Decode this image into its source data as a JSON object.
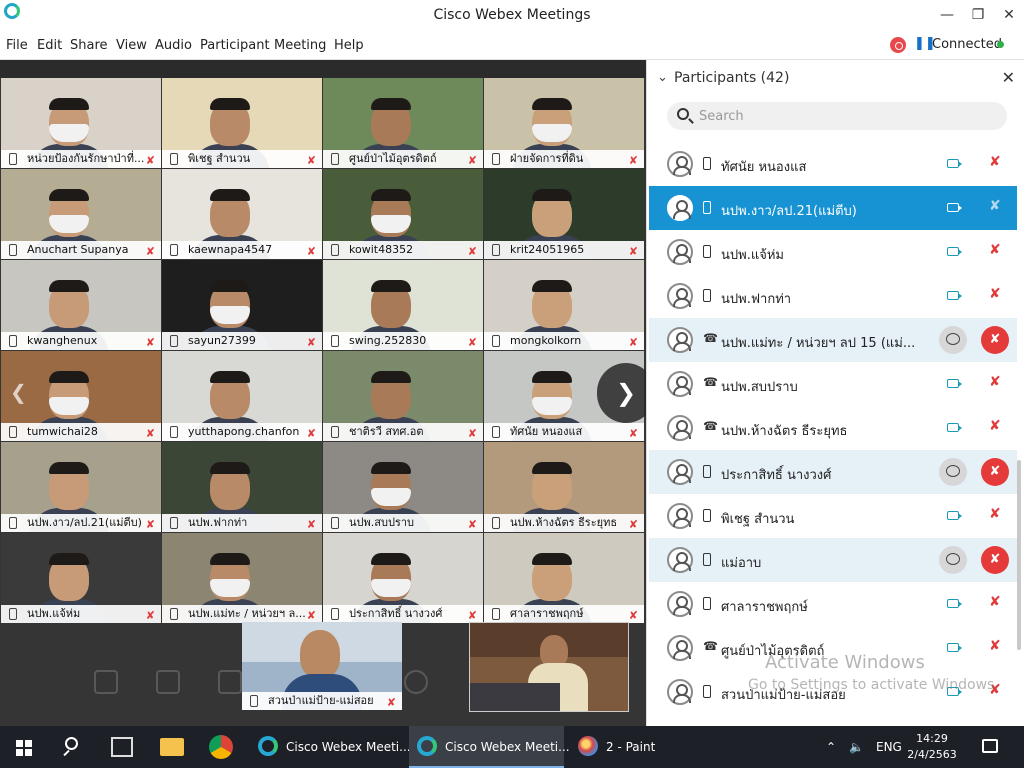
{
  "window": {
    "title": "Cisco Webex Meetings"
  },
  "menu": [
    "File",
    "Edit",
    "Share",
    "View",
    "Audio",
    "Participant",
    "Meeting",
    "Help"
  ],
  "status": {
    "connected": "Connected"
  },
  "tiles": [
    {
      "name": "หน่วยป้องกันรักษาป่าที่..."
    },
    {
      "name": "พิเชฐ สำนวน"
    },
    {
      "name": "ศูนย์ป่าไม้อุตรดิตถ์"
    },
    {
      "name": "ฝ่ายจัดการที่ดิน"
    },
    {
      "name": "Anuchart Supanya"
    },
    {
      "name": "kaewnapa4547"
    },
    {
      "name": "kowit48352"
    },
    {
      "name": "krit24051965"
    },
    {
      "name": "kwanghenux"
    },
    {
      "name": "sayun27399"
    },
    {
      "name": "swing.252830"
    },
    {
      "name": "mongkolkorn"
    },
    {
      "name": "tumwichai28"
    },
    {
      "name": "yutthapong.chanfon"
    },
    {
      "name": "ชาติรวี สทศ.อต"
    },
    {
      "name": "ทัศนัย หนองแส"
    },
    {
      "name": "นปพ.งาว/ลป.21(แม่ตีบ)"
    },
    {
      "name": "นปพ.ฟากท่า"
    },
    {
      "name": "นปพ.สบปราบ"
    },
    {
      "name": "นปพ.ห้างฉัตร ธีระยุทธ"
    },
    {
      "name": "นปพ.แจ้ห่ม"
    },
    {
      "name": "นปพ.แม่ทะ / หน่วยฯ ล..."
    },
    {
      "name": "ประกาสิทธิ์ นางวงศ์"
    },
    {
      "name": "ศาลาราชพฤกษ์"
    }
  ],
  "bottom_tiles": [
    {
      "name": "สวนป่าแม่ป้าย-แม่สอย"
    }
  ],
  "panel": {
    "title": "Participants (42)",
    "search_placeholder": "Search",
    "participants": [
      {
        "name": "ทัศนัย หนองแส",
        "state": "normal",
        "device": "phone"
      },
      {
        "name": "นปพ.งาว/ลป.21(แม่ตีบ)",
        "state": "selected",
        "device": "phone"
      },
      {
        "name": "นปพ.แจ้ห่ม",
        "state": "normal",
        "device": "phone"
      },
      {
        "name": "นปพ.ฟากท่า",
        "state": "normal",
        "device": "phone"
      },
      {
        "name": "นปพ.แม่ทะ / หน่วยฯ ลป 15 (แม่...",
        "state": "highlight",
        "device": "audio"
      },
      {
        "name": "นปพ.สบปราบ",
        "state": "normal",
        "device": "audio"
      },
      {
        "name": "นปพ.ห้างฉัตร ธีระยุทธ",
        "state": "normal",
        "device": "audio"
      },
      {
        "name": "ประกาสิทธิ์ นางวงศ์",
        "state": "highlight",
        "device": "phone"
      },
      {
        "name": "พิเชฐ สำนวน",
        "state": "normal",
        "device": "phone"
      },
      {
        "name": "แม่อาบ",
        "state": "highlight",
        "device": "phone"
      },
      {
        "name": "ศาลาราชพฤกษ์",
        "state": "normal",
        "device": "phone"
      },
      {
        "name": "ศูนย์ป่าไม้อุตรดิตถ์",
        "state": "normal",
        "device": "audio"
      },
      {
        "name": "สวนป่าแม่ป้าย-แม่สอย",
        "state": "normal",
        "device": "phone"
      }
    ]
  },
  "watermark": {
    "line1": "Activate Windows",
    "line2": "Go to Settings to activate Windows."
  },
  "taskbar": {
    "items": [
      "Cisco Webex Meeti...",
      "Cisco Webex Meeti...",
      "2 - Paint"
    ],
    "lang": "ENG",
    "time": "14:29",
    "date": "2/4/2563"
  }
}
